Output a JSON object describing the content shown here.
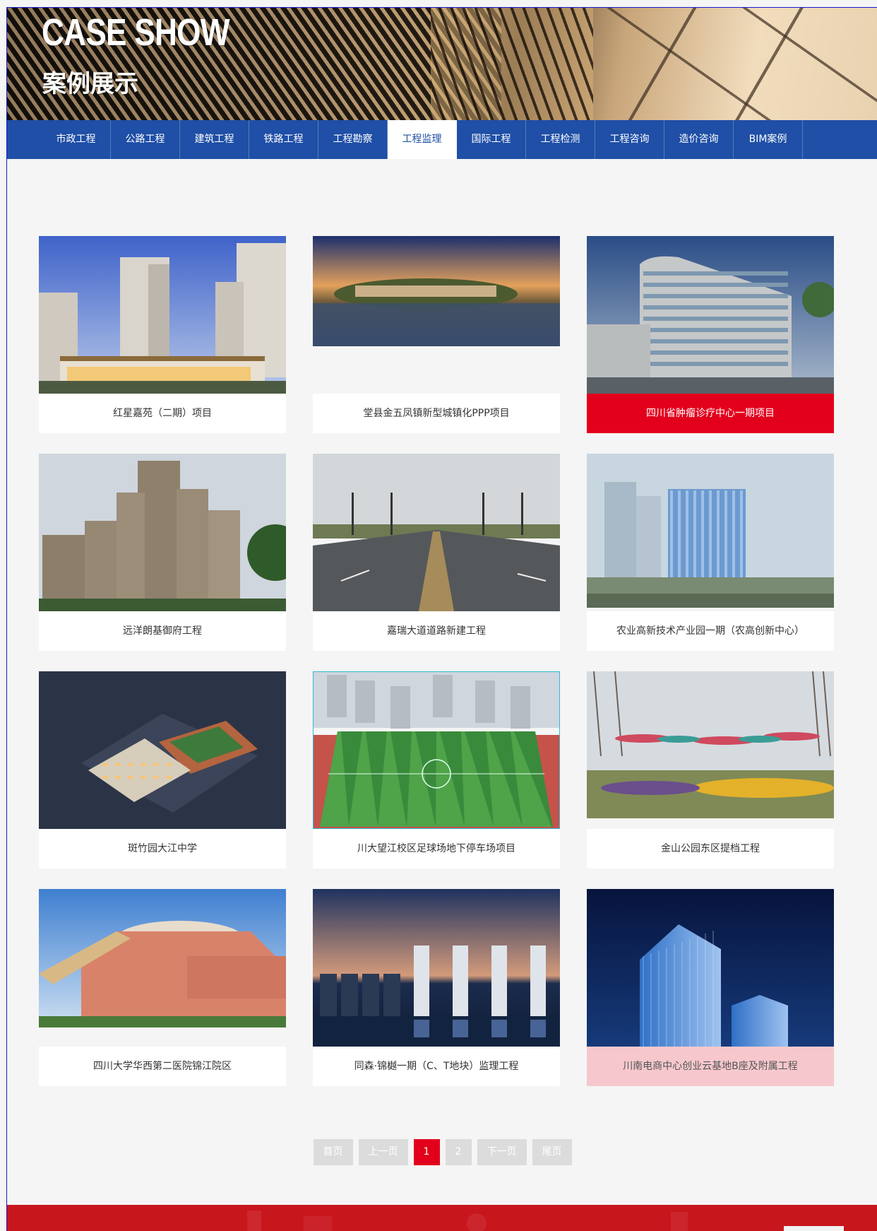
{
  "banner": {
    "title_en": "CASE SHOW",
    "title_cn": "案例展示"
  },
  "nav": {
    "items": [
      "市政工程",
      "公路工程",
      "建筑工程",
      "铁路工程",
      "工程勘察",
      "工程监理",
      "国际工程",
      "工程检测",
      "工程咨询",
      "造价咨询",
      "BIM案例"
    ],
    "active": "工程监理"
  },
  "cases": [
    {
      "title": "红星嘉苑（二期）项目",
      "image": "residential-towers-photo"
    },
    {
      "title": "堂县金五凤镇新型城镇化PPP项目",
      "image": "lakeside-town-sunset-photo"
    },
    {
      "title": "四川省肿瘤诊疗中心一期项目",
      "image": "hospital-building-photo",
      "state": "highlighted"
    },
    {
      "title": "远洋朗基御府工程",
      "image": "highrise-apartments-photo"
    },
    {
      "title": "嘉瑞大道道路新建工程",
      "image": "boulevard-road-photo"
    },
    {
      "title": "农业高新技术产业园一期（农高创新中心）",
      "image": "glass-office-building-photo"
    },
    {
      "title": "斑竹园大江中学",
      "image": "school-campus-aerial-photo"
    },
    {
      "title": "川大望江校区足球场地下停车场项目",
      "image": "football-field-aerial-photo"
    },
    {
      "title": "金山公园东区提档工程",
      "image": "park-canopies-photo"
    },
    {
      "title": "四川大学华西第二医院锦江院区",
      "image": "round-hospital-building-photo"
    },
    {
      "title": "同森·锦樾一期（C、T地块）监理工程",
      "image": "riverside-skyline-night-photo"
    },
    {
      "title": "川南电商中心创业云基地B座及附属工程",
      "image": "blue-glass-towers-night-photo",
      "state": "hover"
    }
  ],
  "pagination": {
    "first": "首页",
    "prev": "上一页",
    "pages": [
      "1",
      "2"
    ],
    "current": "1",
    "next": "下一页",
    "last": "尾页"
  },
  "colors": {
    "nav": "#1f4fa6",
    "accent": "#e3001c",
    "footer": "#c8161d"
  }
}
